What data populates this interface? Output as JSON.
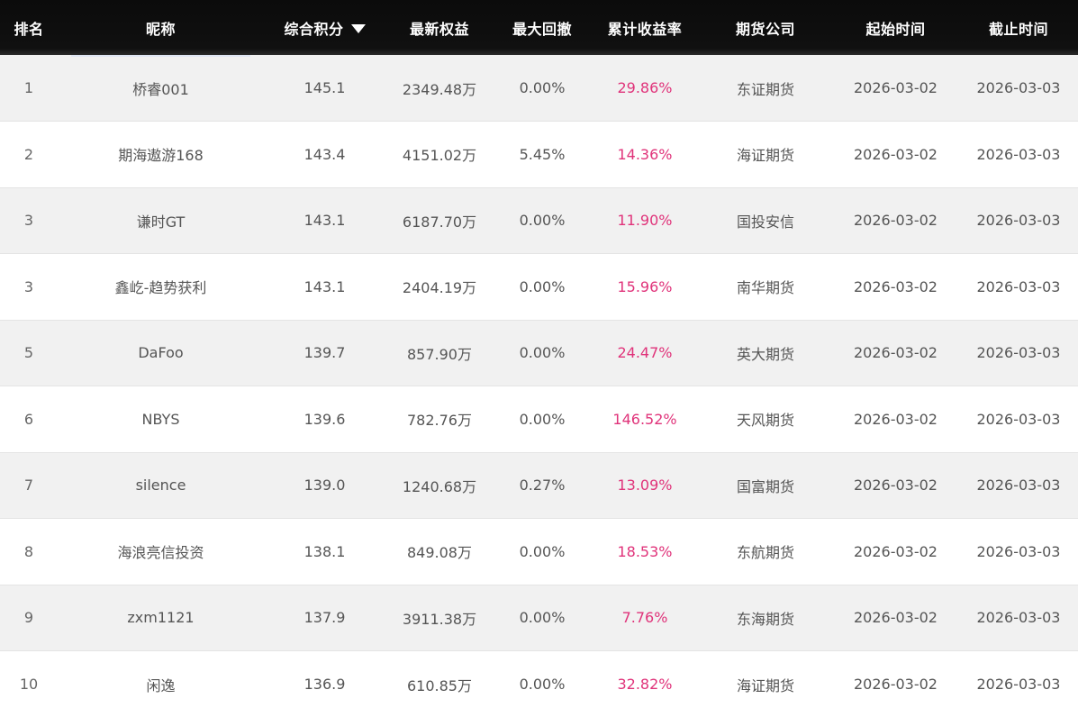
{
  "header": {
    "rank": "排名",
    "nickname": "昵称",
    "score": "综合积分",
    "equity": "最新权益",
    "drawdown": "最大回撤",
    "return": "累计收益率",
    "company": "期货公司",
    "start": "起始时间",
    "end": "截止时间"
  },
  "colors": {
    "header_bg": "#0d0d0d",
    "row_odd": "#f1f1f1",
    "row_even": "#ffffff",
    "return_text": "#e0337a",
    "body_text": "#555555"
  },
  "rows": [
    {
      "rank": "1",
      "nickname": "桥睿001",
      "score": "145.1",
      "equity": "2349.48万",
      "drawdown": "0.00%",
      "return": "29.86%",
      "company": "东证期货",
      "start": "2026-03-02",
      "end": "2026-03-03"
    },
    {
      "rank": "2",
      "nickname": "期海遨游168",
      "score": "143.4",
      "equity": "4151.02万",
      "drawdown": "5.45%",
      "return": "14.36%",
      "company": "海证期货",
      "start": "2026-03-02",
      "end": "2026-03-03"
    },
    {
      "rank": "3",
      "nickname": "谦时GT",
      "score": "143.1",
      "equity": "6187.70万",
      "drawdown": "0.00%",
      "return": "11.90%",
      "company": "国投安信",
      "start": "2026-03-02",
      "end": "2026-03-03"
    },
    {
      "rank": "3",
      "nickname": "鑫屹-趋势获利",
      "score": "143.1",
      "equity": "2404.19万",
      "drawdown": "0.00%",
      "return": "15.96%",
      "company": "南华期货",
      "start": "2026-03-02",
      "end": "2026-03-03"
    },
    {
      "rank": "5",
      "nickname": "DaFoo",
      "score": "139.7",
      "equity": "857.90万",
      "drawdown": "0.00%",
      "return": "24.47%",
      "company": "英大期货",
      "start": "2026-03-02",
      "end": "2026-03-03"
    },
    {
      "rank": "6",
      "nickname": "NBYS",
      "score": "139.6",
      "equity": "782.76万",
      "drawdown": "0.00%",
      "return": "146.52%",
      "company": "天风期货",
      "start": "2026-03-02",
      "end": "2026-03-03"
    },
    {
      "rank": "7",
      "nickname": "silence",
      "score": "139.0",
      "equity": "1240.68万",
      "drawdown": "0.27%",
      "return": "13.09%",
      "company": "国富期货",
      "start": "2026-03-02",
      "end": "2026-03-03"
    },
    {
      "rank": "8",
      "nickname": "海浪亮信投资",
      "score": "138.1",
      "equity": "849.08万",
      "drawdown": "0.00%",
      "return": "18.53%",
      "company": "东航期货",
      "start": "2026-03-02",
      "end": "2026-03-03"
    },
    {
      "rank": "9",
      "nickname": "zxm1121",
      "score": "137.9",
      "equity": "3911.38万",
      "drawdown": "0.00%",
      "return": "7.76%",
      "company": "东海期货",
      "start": "2026-03-02",
      "end": "2026-03-03"
    },
    {
      "rank": "10",
      "nickname": "闲逸",
      "score": "136.9",
      "equity": "610.85万",
      "drawdown": "0.00%",
      "return": "32.82%",
      "company": "海证期货",
      "start": "2026-03-02",
      "end": "2026-03-03"
    }
  ]
}
